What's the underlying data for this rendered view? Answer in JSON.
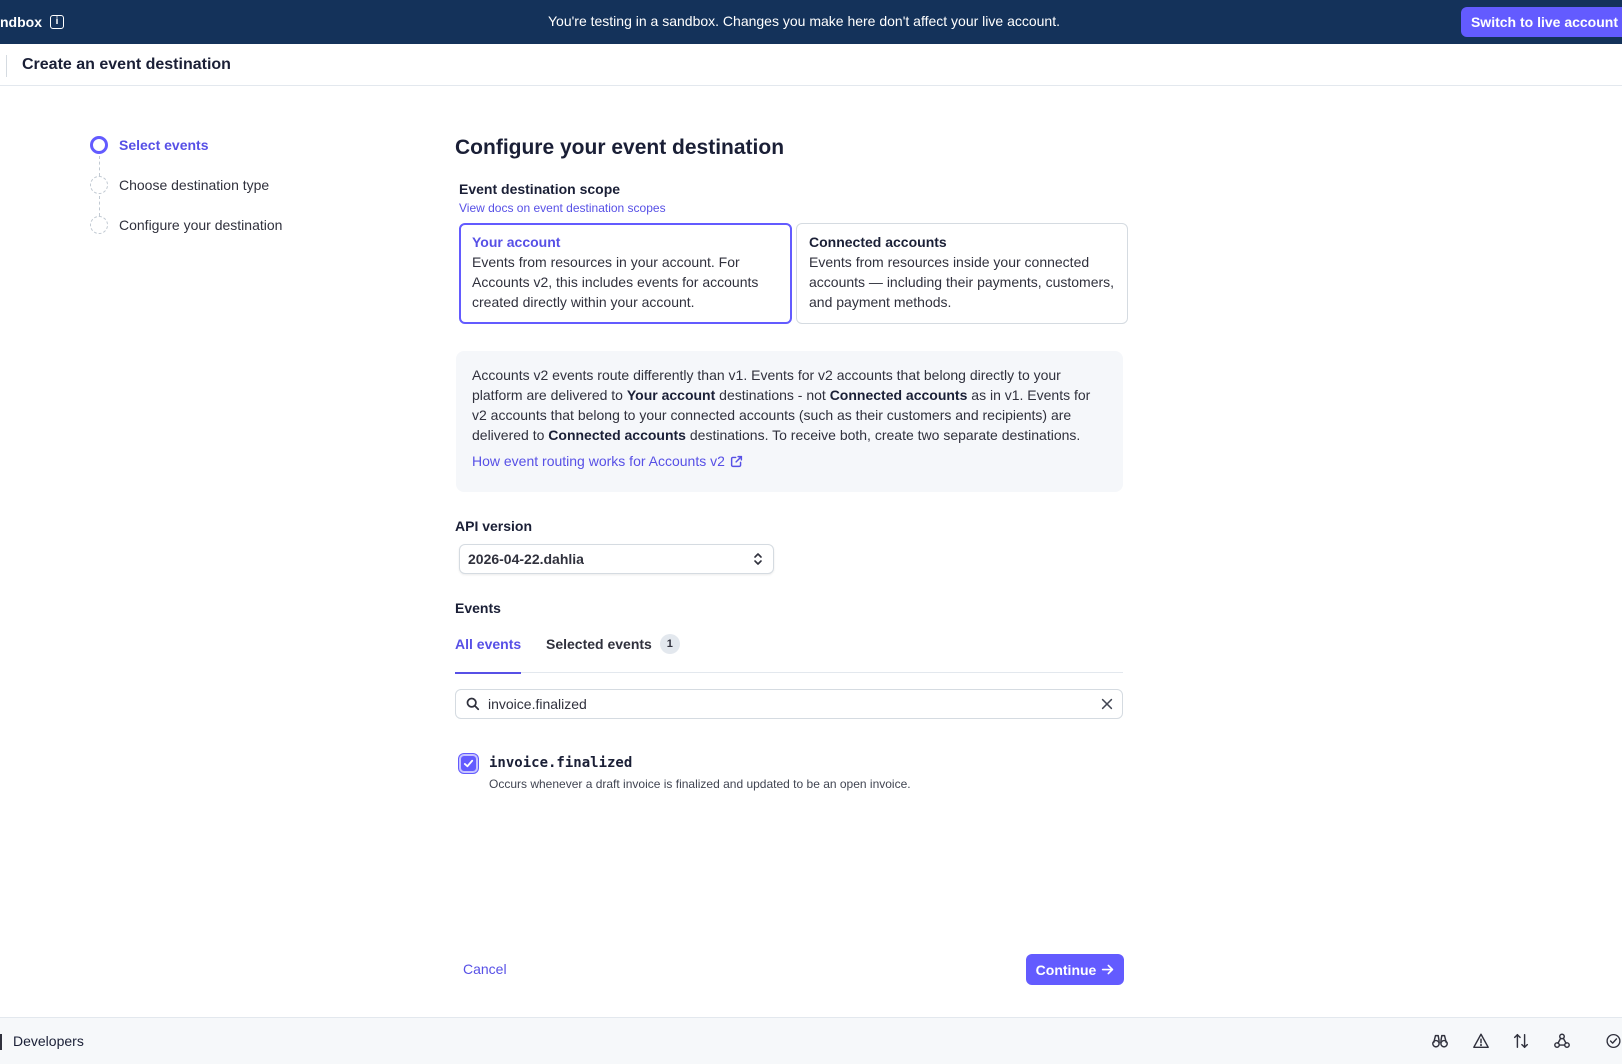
{
  "banner": {
    "sandbox_label": "ndbox",
    "message": "You're testing in a sandbox. Changes you make here don't affect your live account.",
    "switch_button": "Switch to live account"
  },
  "header": {
    "title": "Create an event destination"
  },
  "stepper": {
    "steps": [
      {
        "label": "Select events",
        "state": "active"
      },
      {
        "label": "Choose destination type",
        "state": "pending"
      },
      {
        "label": "Configure your destination",
        "state": "pending"
      }
    ]
  },
  "main": {
    "title": "Configure your event destination",
    "scope": {
      "label": "Event destination scope",
      "docs_link": "View docs on event destination scopes",
      "options": [
        {
          "title": "Your account",
          "description": "Events from resources in your account. For Accounts v2, this includes events for accounts created directly within your account.",
          "selected": true
        },
        {
          "title": "Connected accounts",
          "description": "Events from resources inside your connected accounts — including their payments, customers, and payment methods.",
          "selected": false
        }
      ]
    },
    "notice": {
      "t1": "Accounts v2 events route differently than v1. Events for v2 accounts that belong directly to your platform are delivered to ",
      "b1": "Your account",
      "t2": " destinations - not ",
      "b2": "Connected accounts",
      "t3": " as in v1. Events for v2 accounts that belong to your connected accounts (such as their customers and recipients) are delivered to ",
      "b3": "Connected accounts",
      "t4": " destinations. To receive both, create two separate destinations.",
      "link": "How event routing works for Accounts v2"
    },
    "api_version": {
      "label": "API version",
      "value": "2026-04-22.dahlia"
    },
    "events": {
      "label": "Events",
      "tabs": {
        "all": "All events",
        "selected": "Selected events",
        "selected_count": "1"
      },
      "search_value": "invoice.finalized",
      "results": [
        {
          "name": "invoice.finalized",
          "description": "Occurs whenever a draft invoice is finalized and updated to be an open invoice.",
          "checked": true
        }
      ]
    },
    "actions": {
      "cancel": "Cancel",
      "continue": "Continue"
    }
  },
  "footer": {
    "label": "Developers",
    "icons": [
      "binoculars-icon",
      "warning-icon",
      "arrows-updown-icon",
      "webhook-icon",
      "check-circle-icon"
    ]
  },
  "colors": {
    "accent": "#635bff",
    "banner": "#14325a"
  }
}
